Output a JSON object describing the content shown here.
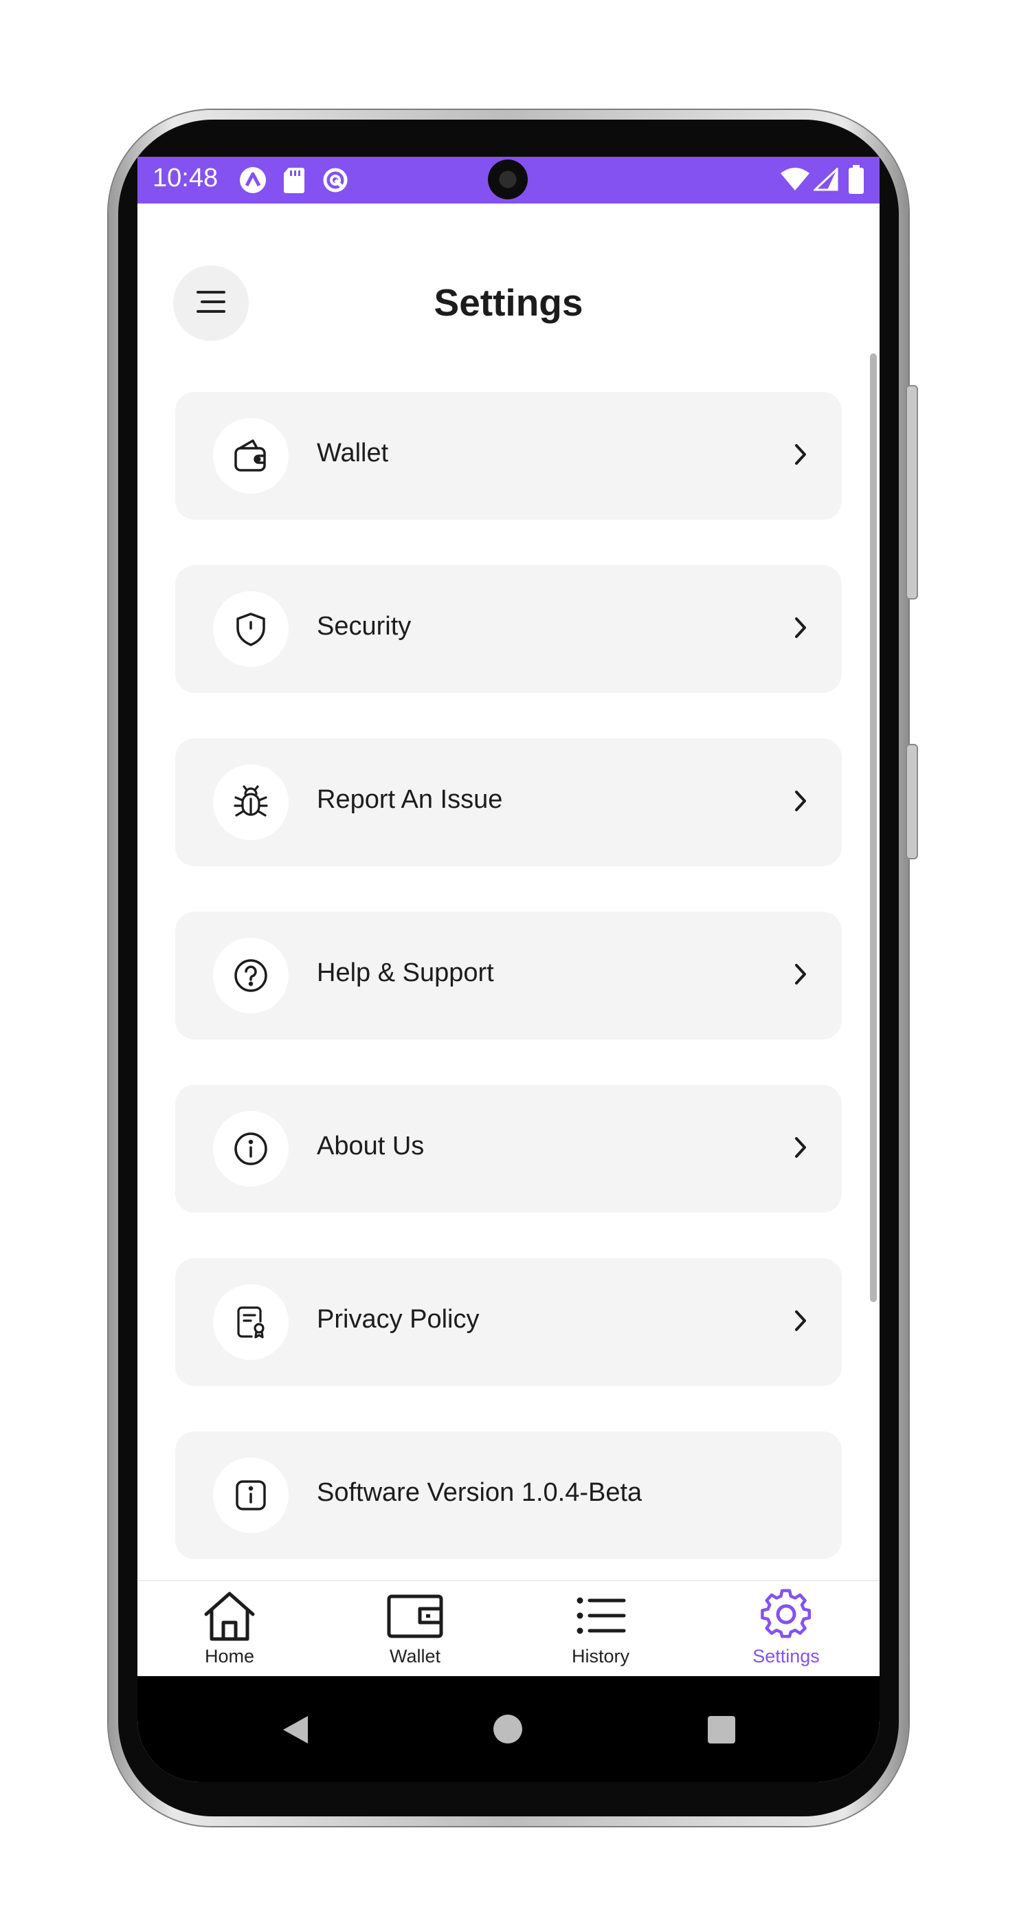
{
  "status_bar": {
    "time": "10:48",
    "background": "#8452f0",
    "left_icons": [
      "a-logo-icon",
      "sd-card-icon",
      "sync-icon"
    ],
    "right_icons": [
      "wifi-icon",
      "signal-icon",
      "battery-icon"
    ]
  },
  "header": {
    "title": "Settings",
    "menu_icon": "menu-icon"
  },
  "settings_items": [
    {
      "label": "Wallet",
      "icon": "wallet-icon",
      "has_chevron": true
    },
    {
      "label": "Security",
      "icon": "shield-icon",
      "has_chevron": true
    },
    {
      "label": "Report An Issue",
      "icon": "bug-icon",
      "has_chevron": true
    },
    {
      "label": "Help & Support",
      "icon": "help-circle-icon",
      "has_chevron": true
    },
    {
      "label": "About Us",
      "icon": "info-circle-icon",
      "has_chevron": true
    },
    {
      "label": "Privacy Policy",
      "icon": "policy-document-icon",
      "has_chevron": true
    },
    {
      "label": "Software Version 1.0.4-Beta",
      "icon": "info-square-icon",
      "has_chevron": false
    }
  ],
  "bottom_nav": {
    "items": [
      {
        "label": "Home",
        "icon": "home-icon"
      },
      {
        "label": "Wallet",
        "icon": "wallet-icon"
      },
      {
        "label": "History",
        "icon": "list-icon"
      },
      {
        "label": "Settings",
        "icon": "gear-icon"
      }
    ],
    "active": "Settings",
    "accent": "#8452f0"
  },
  "system_nav": [
    "back-icon",
    "home-circle-icon",
    "recents-icon"
  ]
}
